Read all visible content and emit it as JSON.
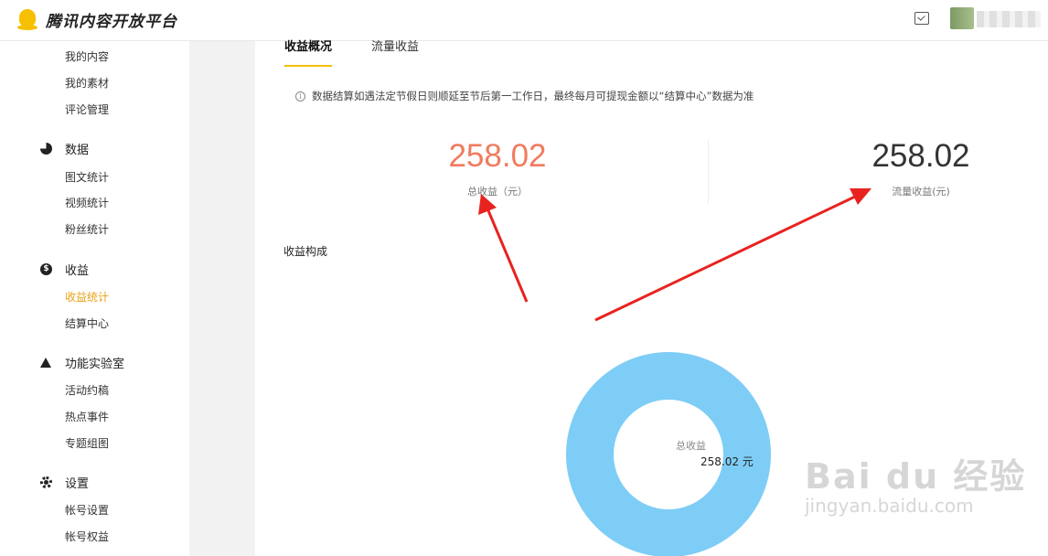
{
  "app": {
    "title": "腾讯内容开放平台"
  },
  "sidebar": {
    "items_top": [
      "我的内容",
      "我的素材",
      "评论管理"
    ],
    "groups": [
      {
        "label": "数据",
        "icon": "pie-chart-icon",
        "items": [
          "图文统计",
          "视频统计",
          "粉丝统计"
        ]
      },
      {
        "label": "收益",
        "icon": "coin-icon",
        "items": [
          "收益统计",
          "结算中心"
        ],
        "active": "收益统计"
      },
      {
        "label": "功能实验室",
        "icon": "flask-icon",
        "items": [
          "活动约稿",
          "热点事件",
          "专题组图"
        ]
      },
      {
        "label": "设置",
        "icon": "gear-icon",
        "items": [
          "帐号设置",
          "帐号权益"
        ]
      }
    ]
  },
  "tabs": [
    {
      "label": "收益概况",
      "active": true
    },
    {
      "label": "流量收益",
      "active": false
    }
  ],
  "notice": "数据结算如遇法定节假日则顺延至节后第一工作日，最终每月可提现金额以“结算中心”数据为准",
  "stats": {
    "total": {
      "value": "258.02",
      "label": "总收益（元）",
      "color": "#f07b5e"
    },
    "traffic": {
      "value": "258.02",
      "label": "流量收益(元)",
      "color": "#333333"
    }
  },
  "composition": {
    "title": "收益构成",
    "center_label": "总收益",
    "center_value": "258.02 元",
    "color": "#7ecdf6"
  },
  "watermark": {
    "brand": "Bai du 经验",
    "sub": "jingyan.baidu.com"
  }
}
